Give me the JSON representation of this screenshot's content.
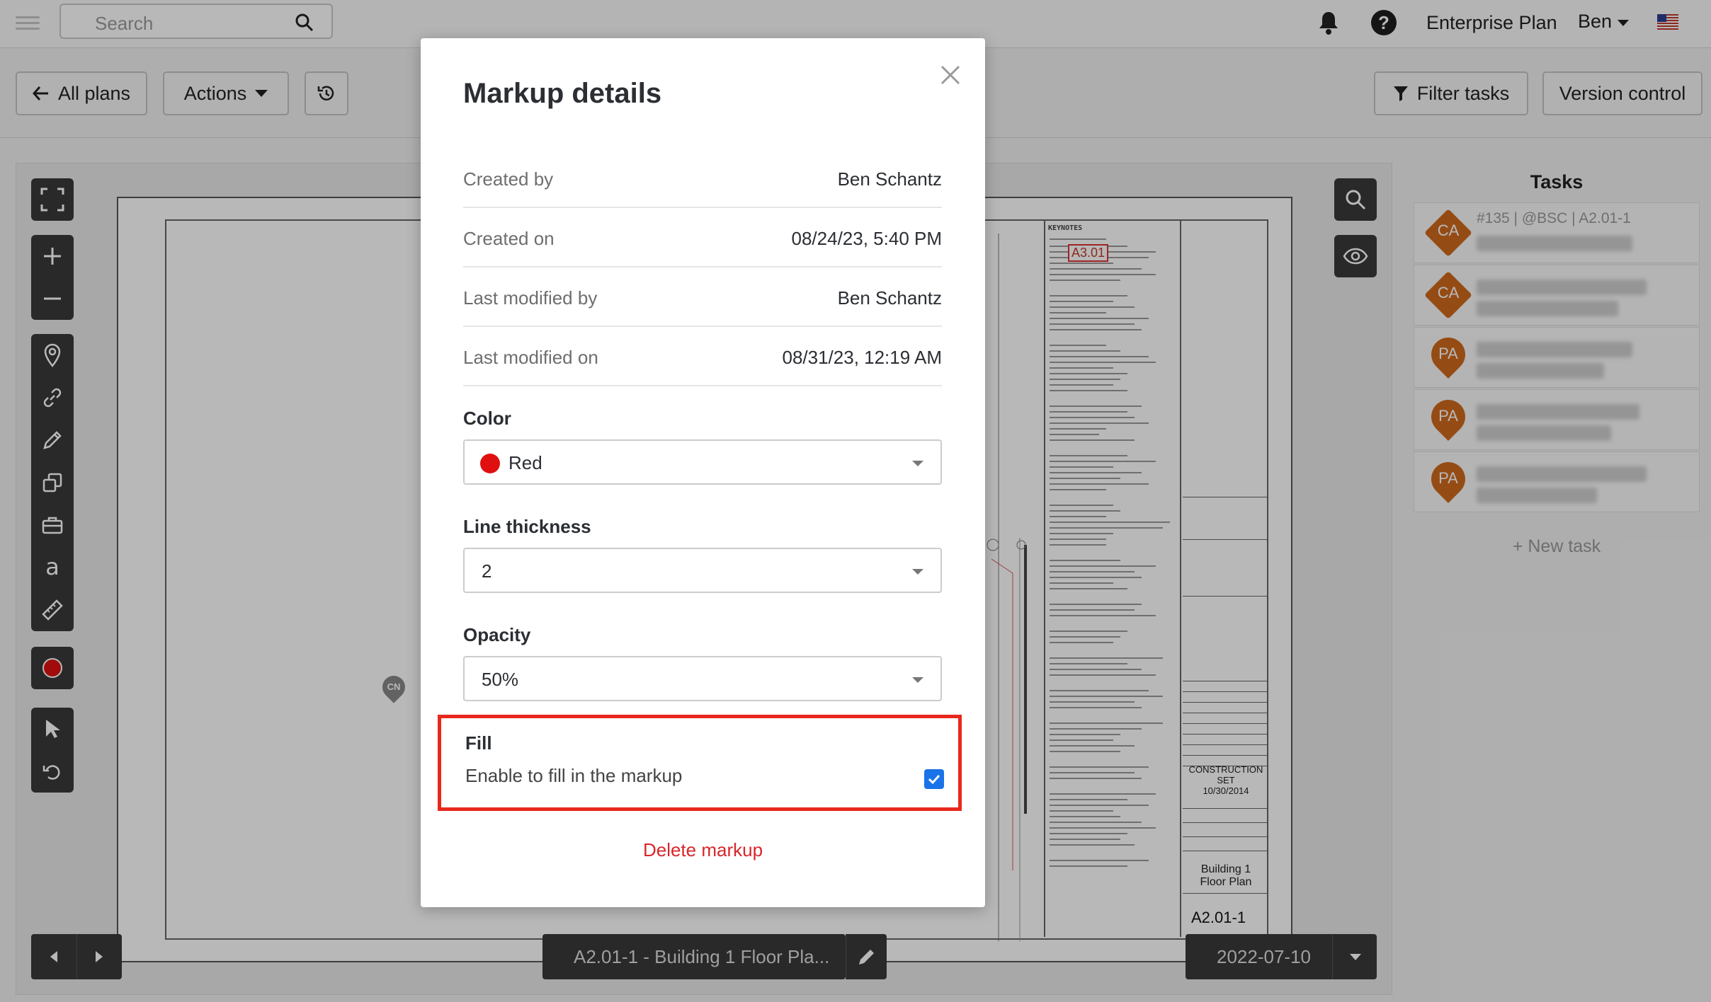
{
  "topbar": {
    "search_placeholder": "Search",
    "plan": "Enterprise Plan",
    "user": "Ben"
  },
  "toolbar": {
    "all_plans": "All plans",
    "actions": "Actions",
    "filter_tasks": "Filter tasks",
    "version_control": "Version control"
  },
  "sheet": {
    "keynotes_header": "KEYNOTES",
    "markup_label": "A3.01",
    "construction_set": "CONSTRUCTION SET",
    "construction_date": "10/30/2014",
    "title": "Building 1 Floor Plan",
    "number": "A2.01-1"
  },
  "pins": {
    "cn": "CN"
  },
  "bottom": {
    "sheet_name": "A2.01-1 - Building 1 Floor Pla...",
    "date": "2022-07-10"
  },
  "tasks": {
    "title": "Tasks",
    "items": [
      {
        "badge": "CA",
        "meta": "#135 | @BSC | A2.01-1"
      },
      {
        "badge": "CA",
        "meta": ""
      },
      {
        "badge": "PA",
        "meta": ""
      },
      {
        "badge": "PA",
        "meta": ""
      },
      {
        "badge": "PA",
        "meta": ""
      }
    ],
    "new_task": "+ New task"
  },
  "modal": {
    "title": "Markup details",
    "rows": [
      {
        "label": "Created by",
        "value": "Ben Schantz"
      },
      {
        "label": "Created on",
        "value": "08/24/23, 5:40 PM"
      },
      {
        "label": "Last modified by",
        "value": "Ben Schantz"
      },
      {
        "label": "Last modified on",
        "value": "08/31/23, 12:19 AM"
      }
    ],
    "color_label": "Color",
    "color_value": "Red",
    "color_hex": "#e01010",
    "thickness_label": "Line thickness",
    "thickness_value": "2",
    "opacity_label": "Opacity",
    "opacity_value": "50%",
    "fill_label": "Fill",
    "fill_desc": "Enable to fill in the markup",
    "fill_checked": true,
    "delete": "Delete markup"
  },
  "colors": {
    "accent": "#1a73e8",
    "danger": "#d9262a",
    "highlight": "#e8281c",
    "task_orange": "#cf6a1d"
  }
}
